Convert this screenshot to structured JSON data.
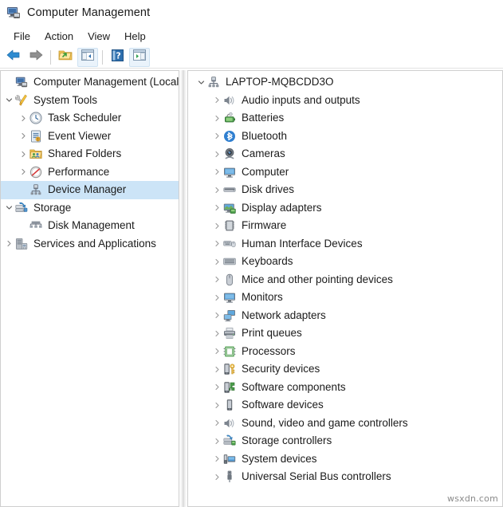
{
  "window": {
    "title": "Computer Management",
    "icon": "computer-management-icon"
  },
  "menubar": {
    "items": [
      {
        "label": "File",
        "name": "menu-file"
      },
      {
        "label": "Action",
        "name": "menu-action"
      },
      {
        "label": "View",
        "name": "menu-view"
      },
      {
        "label": "Help",
        "name": "menu-help"
      }
    ]
  },
  "toolbar": {
    "buttons": [
      {
        "icon": "back-arrow-icon",
        "name": "toolbar-back"
      },
      {
        "icon": "forward-arrow-icon",
        "name": "toolbar-forward"
      },
      {
        "icon": "export-list-icon",
        "name": "toolbar-export-list"
      },
      {
        "icon": "show-hide-console-tree-icon",
        "name": "toolbar-show-hide-console-tree"
      },
      {
        "icon": "help-icon",
        "name": "toolbar-help"
      },
      {
        "icon": "show-hide-action-pane-icon",
        "name": "toolbar-show-hide-action-pane"
      }
    ]
  },
  "console_tree": {
    "root": {
      "label": "Computer Management (Local)",
      "icon": "computer-management-icon",
      "level": 0,
      "expander": "none"
    },
    "items": [
      {
        "label": "System Tools",
        "icon": "system-tools-icon",
        "level": 1,
        "expander": "expanded"
      },
      {
        "label": "Task Scheduler",
        "icon": "task-scheduler-icon",
        "level": 2,
        "expander": "collapsed"
      },
      {
        "label": "Event Viewer",
        "icon": "event-viewer-icon",
        "level": 2,
        "expander": "collapsed"
      },
      {
        "label": "Shared Folders",
        "icon": "shared-folders-icon",
        "level": 2,
        "expander": "collapsed"
      },
      {
        "label": "Performance",
        "icon": "performance-icon",
        "level": 2,
        "expander": "collapsed"
      },
      {
        "label": "Device Manager",
        "icon": "device-manager-icon",
        "level": 2,
        "expander": "none",
        "selected": true
      },
      {
        "label": "Storage",
        "icon": "storage-icon",
        "level": 1,
        "expander": "expanded"
      },
      {
        "label": "Disk Management",
        "icon": "disk-management-icon",
        "level": 2,
        "expander": "none"
      },
      {
        "label": "Services and Applications",
        "icon": "services-apps-icon",
        "level": 1,
        "expander": "collapsed"
      }
    ]
  },
  "device_tree": {
    "root": {
      "label": "LAPTOP-MQBCDD3O",
      "icon": "computer-node-icon",
      "expander": "expanded"
    },
    "items": [
      {
        "label": "Audio inputs and outputs",
        "icon": "speaker-icon"
      },
      {
        "label": "Batteries",
        "icon": "battery-icon"
      },
      {
        "label": "Bluetooth",
        "icon": "bluetooth-icon"
      },
      {
        "label": "Cameras",
        "icon": "camera-icon"
      },
      {
        "label": "Computer",
        "icon": "monitor-icon"
      },
      {
        "label": "Disk drives",
        "icon": "disk-drive-icon"
      },
      {
        "label": "Display adapters",
        "icon": "display-adapter-icon"
      },
      {
        "label": "Firmware",
        "icon": "firmware-icon"
      },
      {
        "label": "Human Interface Devices",
        "icon": "hid-icon"
      },
      {
        "label": "Keyboards",
        "icon": "keyboard-icon"
      },
      {
        "label": "Mice and other pointing devices",
        "icon": "mouse-icon"
      },
      {
        "label": "Monitors",
        "icon": "monitor-icon"
      },
      {
        "label": "Network adapters",
        "icon": "network-adapter-icon"
      },
      {
        "label": "Print queues",
        "icon": "printer-icon"
      },
      {
        "label": "Processors",
        "icon": "processor-icon"
      },
      {
        "label": "Security devices",
        "icon": "security-device-icon"
      },
      {
        "label": "Software components",
        "icon": "software-component-icon"
      },
      {
        "label": "Software devices",
        "icon": "software-device-icon"
      },
      {
        "label": "Sound, video and game controllers",
        "icon": "sound-controller-icon"
      },
      {
        "label": "Storage controllers",
        "icon": "storage-controller-icon"
      },
      {
        "label": "System devices",
        "icon": "system-device-icon"
      },
      {
        "label": "Universal Serial Bus controllers",
        "icon": "usb-controller-icon"
      }
    ]
  },
  "watermark": {
    "text": "wsxdn.com"
  },
  "colors": {
    "selection": "#cce4f7",
    "accent": "#2f7fd0",
    "text": "#1b1b1b",
    "border": "#cfcfcf"
  }
}
